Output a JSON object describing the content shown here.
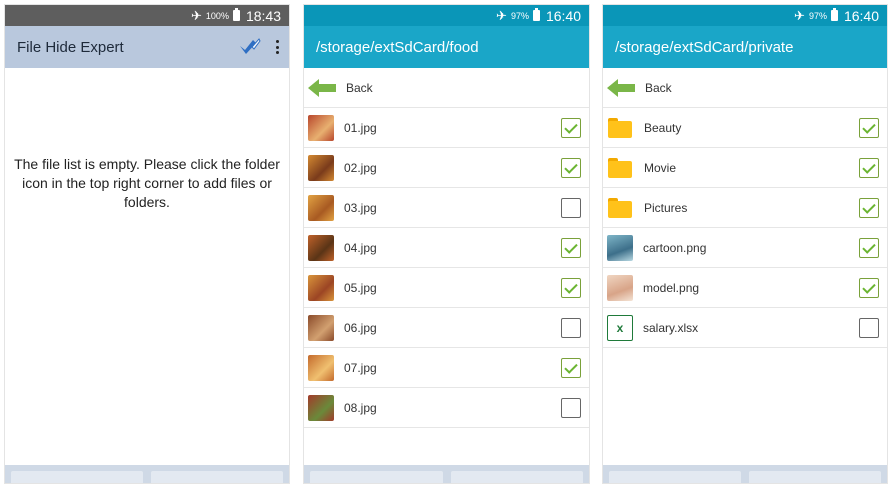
{
  "screen1": {
    "status": {
      "battery": "100%",
      "time": "18:43"
    },
    "title": "File Hide Expert",
    "icons": {
      "brush": "brush-icon",
      "more": "more-vert-icon"
    },
    "empty_message": "The file list is empty. Please click the folder icon in the top right corner to add files or folders."
  },
  "screen2": {
    "status": {
      "battery": "97%",
      "time": "16:40"
    },
    "path": "/storage/extSdCard/food",
    "back_label": "Back",
    "items": [
      {
        "name": "01.jpg",
        "checked": true
      },
      {
        "name": "02.jpg",
        "checked": true
      },
      {
        "name": "03.jpg",
        "checked": false
      },
      {
        "name": "04.jpg",
        "checked": true
      },
      {
        "name": "05.jpg",
        "checked": true
      },
      {
        "name": "06.jpg",
        "checked": false
      },
      {
        "name": "07.jpg",
        "checked": true
      },
      {
        "name": "08.jpg",
        "checked": false
      }
    ]
  },
  "screen3": {
    "status": {
      "battery": "97%",
      "time": "16:40"
    },
    "path": "/storage/extSdCard/private",
    "back_label": "Back",
    "items": [
      {
        "name": "Beauty",
        "type": "folder",
        "checked": true
      },
      {
        "name": "Movie",
        "type": "folder",
        "checked": true
      },
      {
        "name": "Pictures",
        "type": "folder",
        "checked": true
      },
      {
        "name": "cartoon.png",
        "type": "image",
        "checked": true
      },
      {
        "name": "model.png",
        "type": "image",
        "checked": true
      },
      {
        "name": "salary.xlsx",
        "type": "excel",
        "checked": false
      }
    ]
  },
  "colors": {
    "screen1_status": "#5e5e5e",
    "screen1_appbar": "#b9c8dd",
    "status_teal": "#0a96b8",
    "appbar_teal": "#1aa6c8",
    "check_green": "#6bb532",
    "folder_yellow": "#ffc21a"
  }
}
